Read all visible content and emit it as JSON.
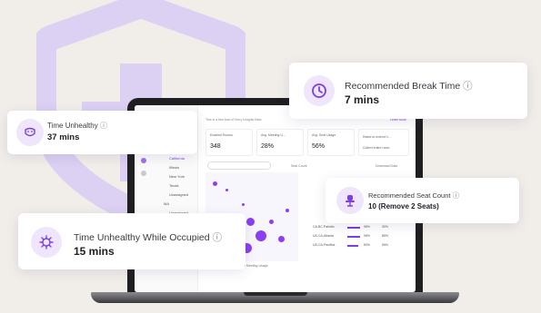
{
  "colors": {
    "background": "#f1eeea",
    "accent": "#7b3fe4",
    "accent_light": "#efe5fc",
    "shield": "#dcd0f3"
  },
  "cards": {
    "break_time": {
      "title": "Recommended Break Time",
      "value": "7 mins",
      "icon": "clock-icon"
    },
    "time_unhealthy": {
      "title": "Time Unhealthy",
      "value": "37 mins",
      "icon": "mask-icon"
    },
    "unhealthy_occupied": {
      "title": "Time Unhealthy While Occupied",
      "value": "15 mins",
      "icon": "virus-icon"
    },
    "seat_count": {
      "title": "Recommended Seat Count",
      "value": "10 (Remove 2 Seats)",
      "icon": "chair-icon"
    }
  },
  "info_glyph": "ⓘ",
  "screen": {
    "banner": "This is a free trial of Gerry Insights Beta",
    "learn_more": "Learn More",
    "locations": [
      "California",
      "Illinois",
      "New York",
      "Texas",
      "Unassigned",
      "MA",
      "Unassigned"
    ],
    "kpis": [
      {
        "label": "Enabled Rooms",
        "value": "348"
      },
      {
        "label": "Avg. Meeting U...",
        "value": "28%"
      },
      {
        "label": "Avg. Seat Usage",
        "value": "56%"
      }
    ],
    "side_actions": [
      "Rated to extend h...",
      "Collect entire room"
    ],
    "seat_count_label": "Seat Count",
    "download": "Download Data",
    "x_axis": "Optimal Meeting Usage",
    "list": [
      {
        "room": "CA-BC Palmito",
        "a": "95%",
        "b": "30%"
      },
      {
        "room": "US-CA-Atlanta",
        "a": "95%",
        "b": "85%"
      },
      {
        "room": "US-CA-Pacifica",
        "a": "80%",
        "b": "55%"
      }
    ]
  }
}
